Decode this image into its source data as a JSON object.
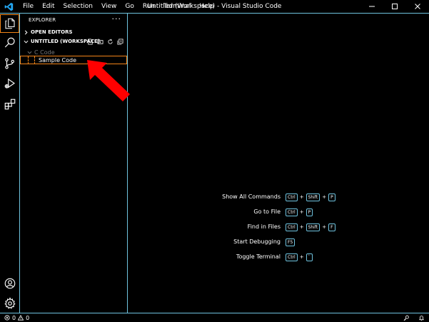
{
  "titlebar": {
    "logo_icon": "vscode-logo-icon",
    "menu": [
      "File",
      "Edit",
      "Selection",
      "View",
      "Go",
      "Run",
      "Terminal",
      "Help"
    ],
    "title": "Untitled (Workspace) - Visual Studio Code",
    "controls": [
      "minimize-icon",
      "maximize-icon",
      "close-icon"
    ]
  },
  "activitybar": {
    "top_icons": [
      "explorer-icon",
      "search-icon",
      "source-control-icon",
      "run-debug-icon",
      "extensions-icon"
    ],
    "bottom_icons": [
      "account-icon",
      "settings-gear-icon"
    ],
    "active": "explorer-icon"
  },
  "sidebar": {
    "header": "EXPLORER",
    "more": "···",
    "open_editors": "OPEN EDITORS",
    "workspace": "UNTITLED (WORKSPACE)",
    "workspace_actions": [
      "new-file-icon",
      "new-folder-icon",
      "refresh-icon",
      "collapse-all-icon"
    ],
    "folder": "C Code",
    "file": "Sample Code"
  },
  "editor": {
    "shortcuts": [
      {
        "label": "Show All Commands",
        "keys": [
          "Ctrl",
          "Shift",
          "P"
        ]
      },
      {
        "label": "Go to File",
        "keys": [
          "Ctrl",
          "P"
        ]
      },
      {
        "label": "Find in Files",
        "keys": [
          "Ctrl",
          "Shift",
          "F"
        ]
      },
      {
        "label": "Start Debugging",
        "keys": [
          "F5"
        ]
      },
      {
        "label": "Toggle Terminal",
        "keys": [
          "Ctrl",
          "`"
        ]
      }
    ]
  },
  "statusbar": {
    "errors": "0",
    "warnings": "0",
    "right_icons": [
      "feedback-icon",
      "notifications-bell-icon"
    ]
  },
  "colors": {
    "border": "#6fc3df",
    "focus": "#f38518",
    "annotation_arrow": "#ff0000"
  }
}
